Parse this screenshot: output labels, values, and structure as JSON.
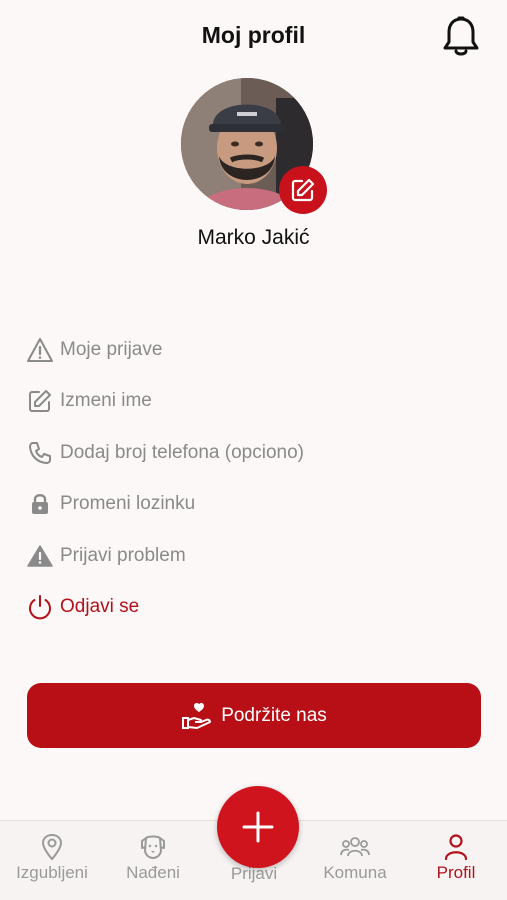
{
  "header": {
    "title": "Moj profil",
    "bell_icon": "bell-icon"
  },
  "profile": {
    "name": "Marko Jakić",
    "edit_icon": "edit-icon"
  },
  "menu": {
    "items": [
      {
        "label": "Moje prijave",
        "icon": "warning-outline-icon"
      },
      {
        "label": "Izmeni ime",
        "icon": "edit-icon"
      },
      {
        "label": "Dodaj broj telefona (opciono)",
        "icon": "phone-icon"
      },
      {
        "label": "Promeni lozinku",
        "icon": "lock-icon"
      },
      {
        "label": "Prijavi problem",
        "icon": "warning-filled-icon"
      },
      {
        "label": "Odjavi se",
        "icon": "power-icon"
      }
    ]
  },
  "support": {
    "label": "Podržite nas",
    "icon": "heart-hand-icon"
  },
  "nav": {
    "items": [
      {
        "label": "Izgubljeni",
        "icon": "location-pin-icon"
      },
      {
        "label": "Nađeni",
        "icon": "dog-icon"
      },
      {
        "label": "Prijavi",
        "icon": "plus-icon"
      },
      {
        "label": "Komuna",
        "icon": "community-icon"
      },
      {
        "label": "Profil",
        "icon": "user-icon"
      }
    ],
    "active": "Profil"
  },
  "colors": {
    "accent": "#c8111a",
    "muted_text": "#8a8a8a",
    "background": "#fbf8f7"
  }
}
